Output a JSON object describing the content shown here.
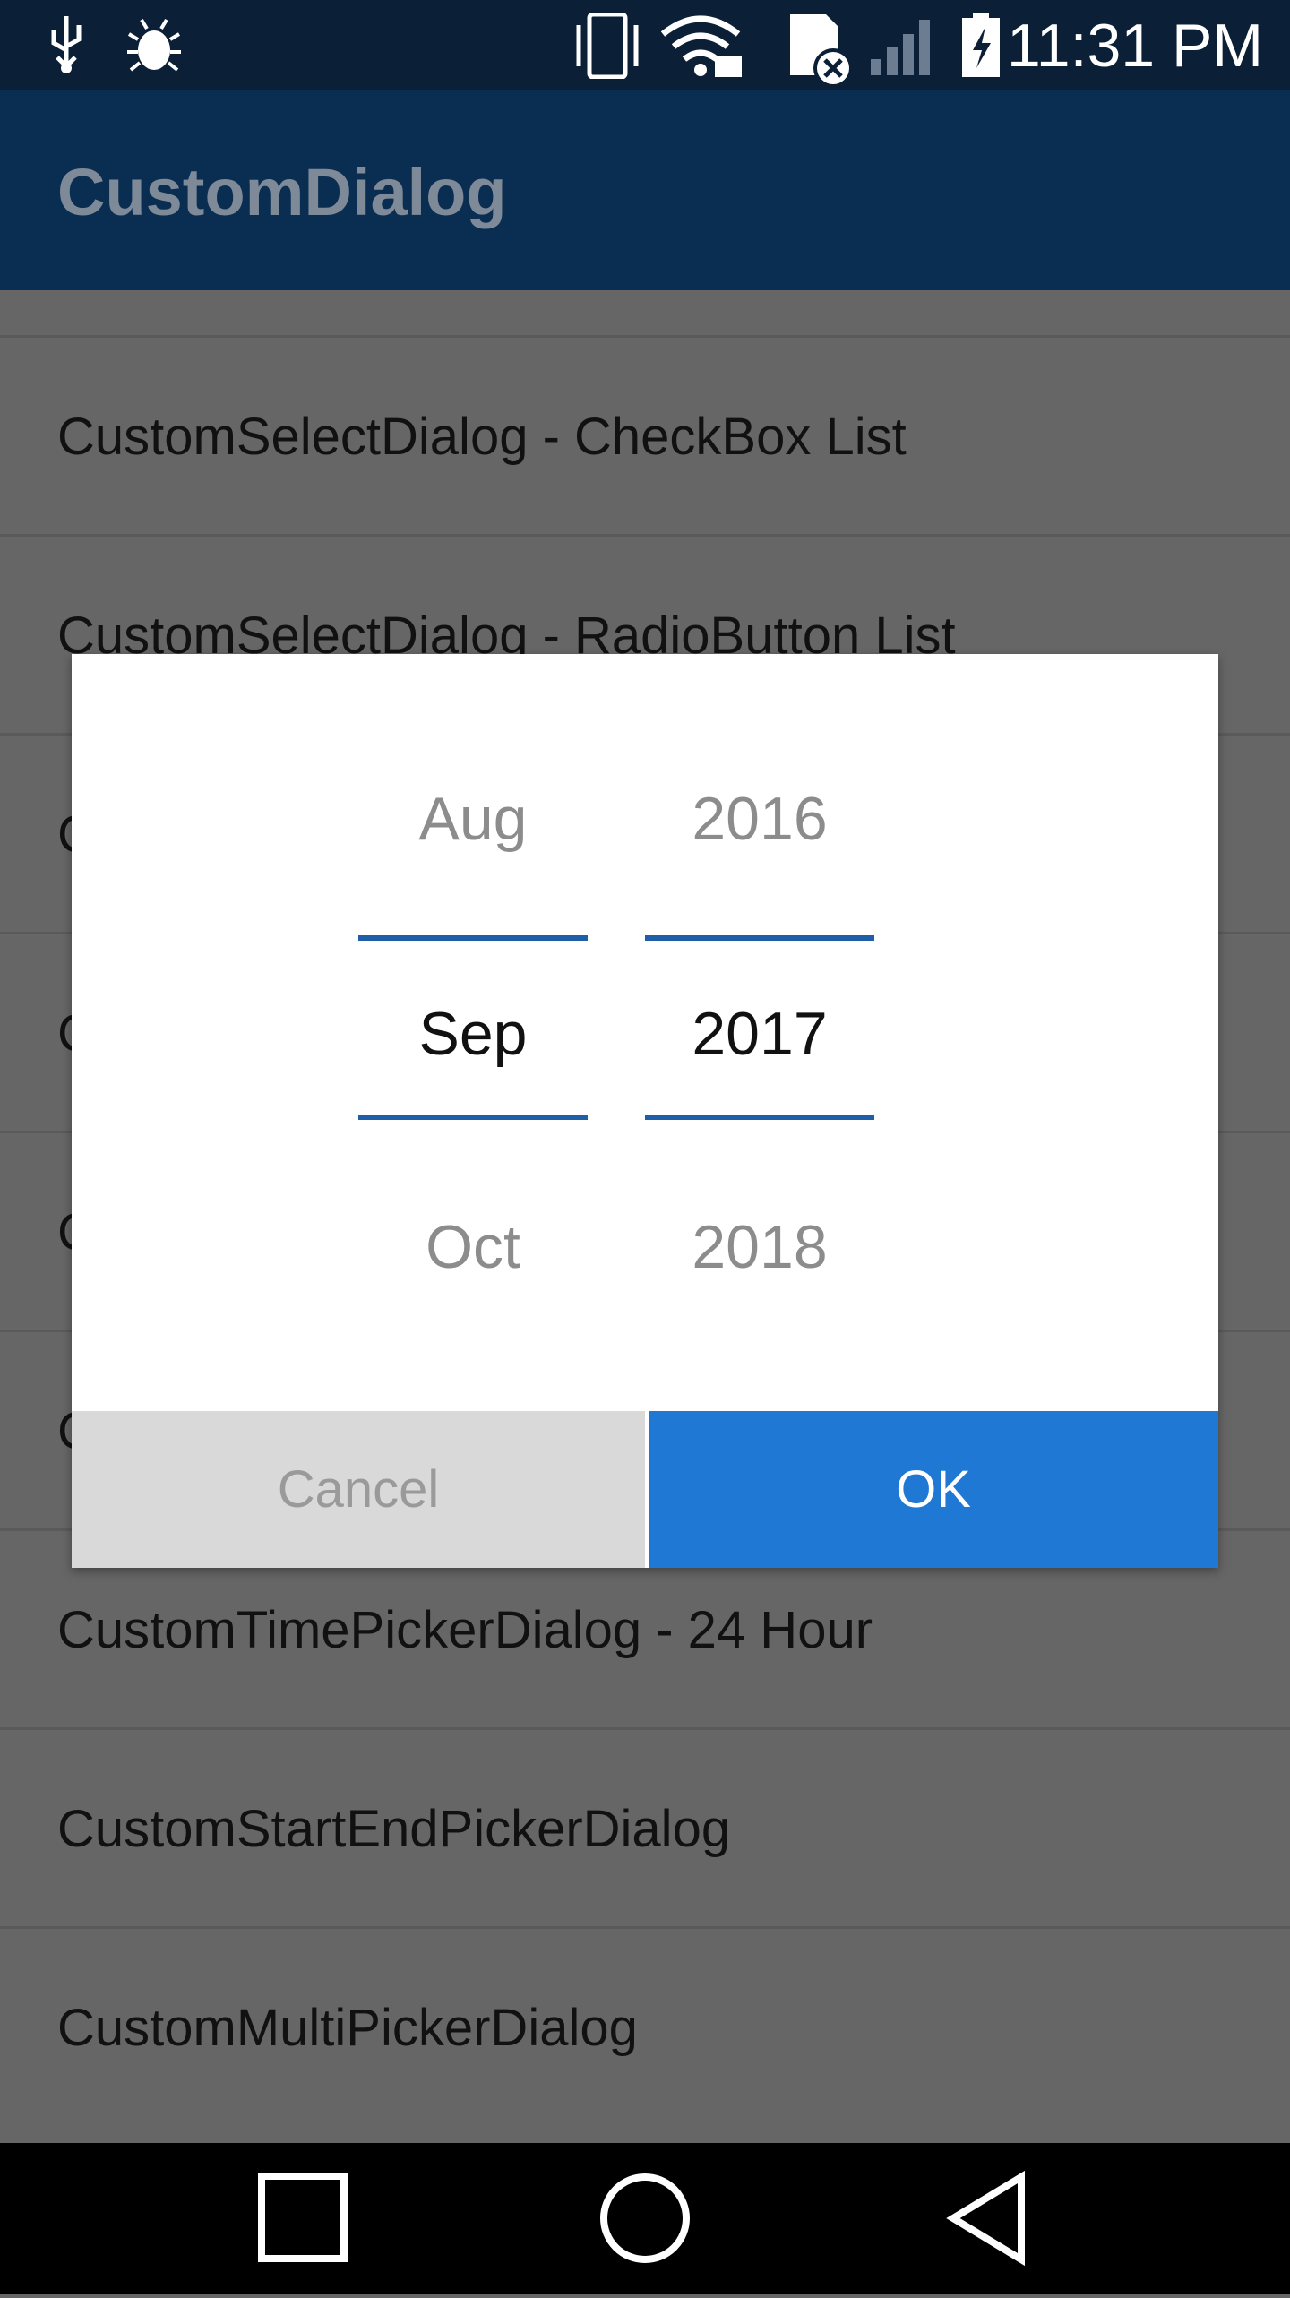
{
  "status_bar": {
    "time": "11:31 PM",
    "icons": [
      "usb-icon",
      "bug-icon",
      "vibrate-icon",
      "wifi-lock-icon",
      "no-sim-icon",
      "signal-icon",
      "battery-charging-icon"
    ]
  },
  "app_bar": {
    "title": "CustomDialog"
  },
  "list": {
    "items": [
      {
        "label": "CustomSelectDialog - CheckBox List"
      },
      {
        "label": "CustomSelectDialog - RadioButton List"
      },
      {
        "label": "C"
      },
      {
        "label": "C"
      },
      {
        "label": "C"
      },
      {
        "label": "C"
      },
      {
        "label": "CustomTimePickerDialog - 24 Hour"
      },
      {
        "label": "CustomStartEndPickerDialog"
      },
      {
        "label": "CustomMultiPickerDialog"
      }
    ]
  },
  "dialog": {
    "month_picker": {
      "prev": "Aug",
      "current": "Sep",
      "next": "Oct"
    },
    "year_picker": {
      "prev": "2016",
      "current": "2017",
      "next": "2018"
    },
    "cancel_label": "Cancel",
    "ok_label": "OK",
    "colors": {
      "accent": "#1e78d4",
      "divider": "#1f5fa8",
      "cancel_bg": "#d9d9d9"
    }
  },
  "nav_bar": {
    "icons": [
      "recents-square-icon",
      "home-circle-icon",
      "back-triangle-icon"
    ]
  }
}
